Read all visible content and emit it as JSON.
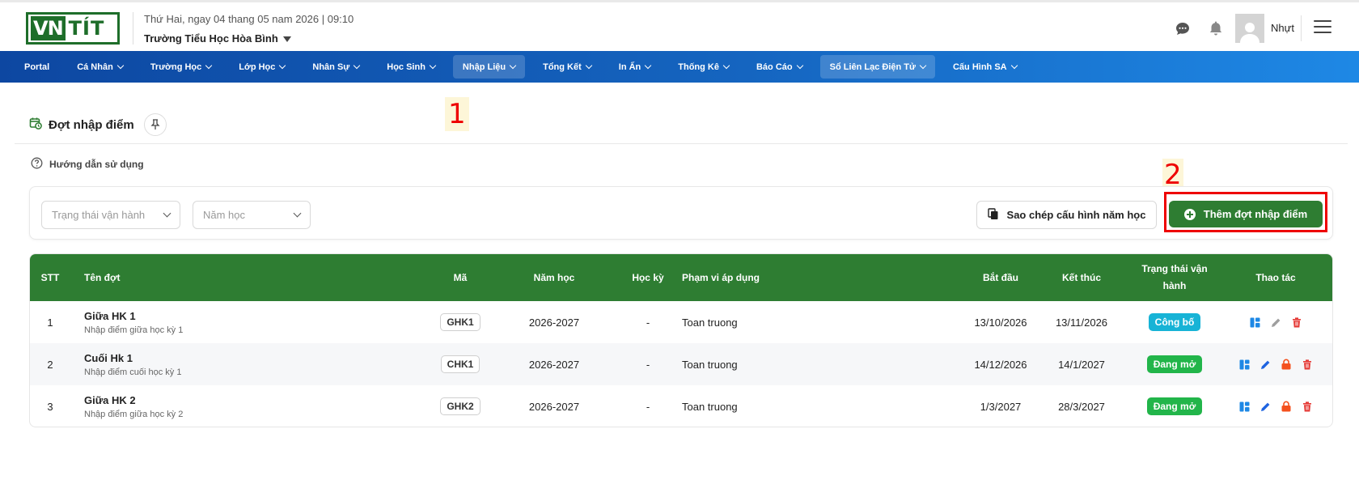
{
  "header": {
    "logo_text_a": "VN",
    "logo_text_b": "TÍT",
    "datetime": "Thứ Hai, ngay 04 thang 05 nam 2026 | 09:10",
    "school": "Trường Tiểu Học Hòa Bình",
    "user_name": "Nhựt"
  },
  "nav": {
    "items": [
      {
        "label": "Portal",
        "has_dropdown": false
      },
      {
        "label": "Cá Nhân",
        "has_dropdown": true
      },
      {
        "label": "Trường Học",
        "has_dropdown": true
      },
      {
        "label": "Lớp Học",
        "has_dropdown": true
      },
      {
        "label": "Nhân Sự",
        "has_dropdown": true
      },
      {
        "label": "Học Sinh",
        "has_dropdown": true
      },
      {
        "label": "Nhập Liệu",
        "has_dropdown": true,
        "active": true
      },
      {
        "label": "Tổng Kết",
        "has_dropdown": true
      },
      {
        "label": "In Ấn",
        "has_dropdown": true
      },
      {
        "label": "Thống Kê",
        "has_dropdown": true
      },
      {
        "label": "Báo Cáo",
        "has_dropdown": true
      },
      {
        "label": "Sổ Liên Lạc Điện Tử",
        "has_dropdown": true,
        "active": true
      },
      {
        "label": "Cấu Hình SA",
        "has_dropdown": true
      }
    ]
  },
  "page": {
    "title": "Đợt nhập điểm",
    "help_label": "Hướng dẫn sử dụng",
    "annotation_1": "1",
    "annotation_2": "2"
  },
  "filters": {
    "status_placeholder": "Trạng thái vận hành",
    "year_placeholder": "Năm học",
    "copy_button": "Sao chép cấu hình năm học",
    "add_button": "Thêm đợt nhập điểm"
  },
  "table": {
    "headers": {
      "stt": "STT",
      "name": "Tên đợt",
      "code": "Mã",
      "year": "Năm học",
      "term": "Học kỳ",
      "scope": "Phạm vi áp dụng",
      "start": "Bắt đầu",
      "end": "Kết thúc",
      "status_line1": "Trạng thái vận",
      "status_line2": "hành",
      "actions": "Thao tác"
    },
    "rows": [
      {
        "stt": "1",
        "name": "Giữa HK 1",
        "desc": "Nhập điểm giữa học kỳ 1",
        "code": "GHK1",
        "year": "2026-2027",
        "term": "-",
        "scope": "Toan truong",
        "start": "13/10/2026",
        "end": "13/11/2026",
        "status": "Công bố",
        "status_color": "#17b3d6",
        "actions": [
          "layout-icon",
          "edit-icon",
          "delete-icon"
        ]
      },
      {
        "stt": "2",
        "name": "Cuối Hk 1",
        "desc": "Nhập điểm cuối học kỳ 1",
        "code": "CHK1",
        "year": "2026-2027",
        "term": "-",
        "scope": "Toan truong",
        "start": "14/12/2026",
        "end": "14/1/2027",
        "status": "Đang mở",
        "status_color": "#22b54a",
        "actions": [
          "layout-icon",
          "edit-icon",
          "lock-icon",
          "delete-icon"
        ]
      },
      {
        "stt": "3",
        "name": "Giữa HK 2",
        "desc": "Nhập điểm giữa học kỳ 2",
        "code": "GHK2",
        "year": "2026-2027",
        "term": "-",
        "scope": "Toan truong",
        "start": "1/3/2027",
        "end": "28/3/2027",
        "status": "Đang mở",
        "status_color": "#22b54a",
        "actions": [
          "layout-icon",
          "edit-icon",
          "lock-icon",
          "delete-icon"
        ]
      }
    ]
  },
  "colors": {
    "brand_green": "#2e7d32",
    "nav_blue": "#1565c0",
    "annotation_red": "#e00000"
  }
}
